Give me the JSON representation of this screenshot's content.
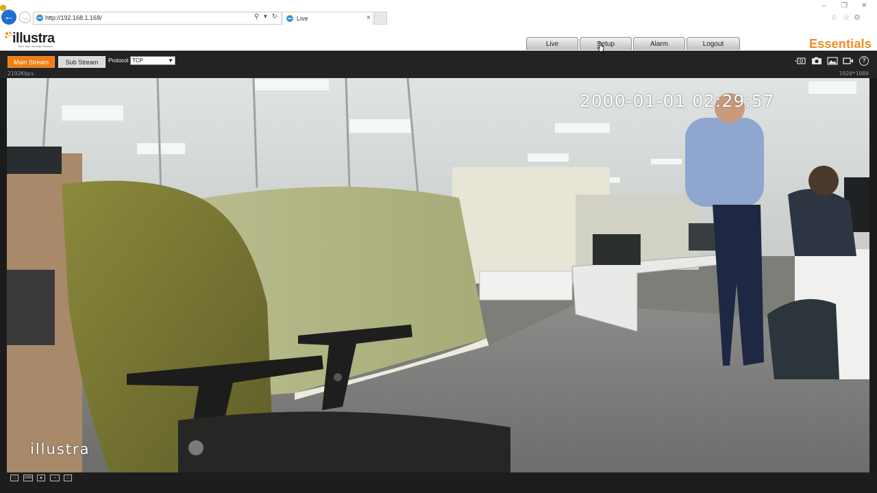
{
  "browser": {
    "url": "http://192.168.1.168/",
    "tab_title": "Live",
    "tab_close": "×",
    "back_glyph": "←",
    "forward_glyph": "→",
    "address_tools": "⚲ ▾ ↻",
    "window_controls": {
      "minimize": "–",
      "maximize": "❐",
      "close": "✕"
    },
    "toolbar_icons": [
      "home-icon",
      "star-icon",
      "gear-icon",
      "smiley-icon"
    ]
  },
  "header": {
    "logo_text": "illustra",
    "logo_tagline": "from Tyco Security Products",
    "brand": "Essentials",
    "brand_color": "#f18a21",
    "nav_tabs": [
      {
        "label": "Live"
      },
      {
        "label": "Setup"
      },
      {
        "label": "Alarm"
      },
      {
        "label": "Logout"
      }
    ]
  },
  "toolbar": {
    "main_stream_label": "Main Stream",
    "sub_stream_label": "Sub Stream",
    "protocol_label": "Protocol",
    "protocol_value": "TCP",
    "bitrate": "2192Kbps",
    "resolution": "1920*1080",
    "accent_color": "#f07c13",
    "icons": [
      "ptz-icon",
      "snapshot-icon",
      "image-settings-icon",
      "record-icon",
      "help-icon"
    ]
  },
  "video": {
    "timestamp": "2000-01-01 02:29:57",
    "watermark": "illustra"
  },
  "bottom_bar": {
    "icons": [
      {
        "name": "fullscreen-icon",
        "glyph": "⛶"
      },
      {
        "name": "zoom-100-icon",
        "glyph": "100%"
      },
      {
        "name": "fit-window-icon",
        "glyph": "▣"
      },
      {
        "name": "stretch-icon",
        "glyph": "⇔"
      },
      {
        "name": "original-size-icon",
        "glyph": "▢"
      }
    ]
  }
}
